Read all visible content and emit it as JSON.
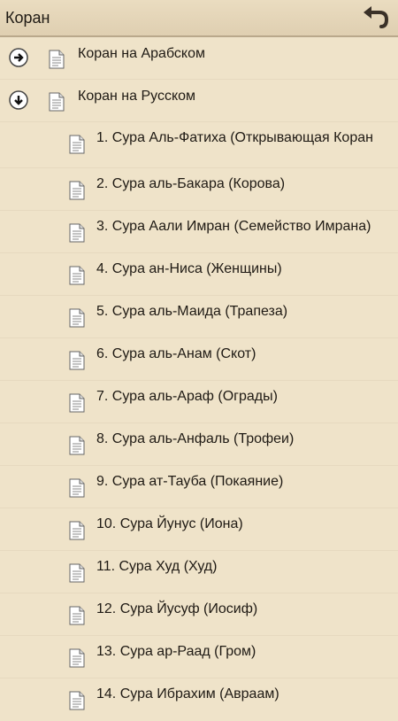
{
  "app": {
    "title": "Коран"
  },
  "sections": [
    {
      "label": "Коран на Арабском",
      "state": "collapsed"
    },
    {
      "label": "Коран на Русском",
      "state": "expanded"
    }
  ],
  "suras": [
    "1. Сура Аль-Фатиха (Открывающая Коран",
    "2. Сура аль-Бакара (Корова)",
    "3. Сура Аали Имран (Семейство Имрана)",
    "4. Сура ан-Ниса (Женщины)",
    "5. Сура аль-Маида (Трапеза)",
    "6. Сура аль-Анам (Скот)",
    "7. Сура аль-Араф (Ограды)",
    "8. Сура аль-Анфаль (Трофеи)",
    "9. Сура ат-Тауба (Покаяние)",
    "10. Сура Йунус (Иона)",
    "11. Сура Худ (Худ)",
    "12. Сура Йусуф (Иосиф)",
    "13. Сура ар-Раад (Гром)",
    "14. Сура Ибрахим (Авраам)"
  ],
  "icons": {
    "back": "back-arrow-icon",
    "collapsed": "arrow-right-circle-icon",
    "expanded": "arrow-down-circle-icon",
    "document": "document-icon"
  }
}
